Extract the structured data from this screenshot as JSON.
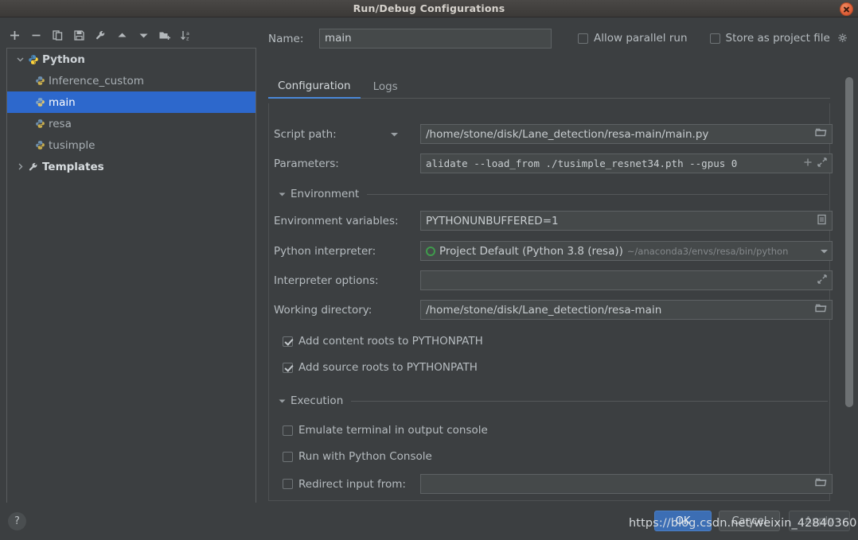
{
  "window": {
    "title": "Run/Debug Configurations",
    "close_icon": "close-icon"
  },
  "sidebar": {
    "toolbar": [
      {
        "name": "add-button",
        "icon": "plus-icon"
      },
      {
        "name": "remove-button",
        "icon": "minus-icon"
      },
      {
        "name": "copy-button",
        "icon": "copy-icon"
      },
      {
        "name": "save-button",
        "icon": "save-icon"
      },
      {
        "name": "edit-templates-button",
        "icon": "wrench-icon"
      },
      {
        "name": "move-up-button",
        "icon": "arrow-up-icon"
      },
      {
        "name": "move-down-button",
        "icon": "arrow-down-icon"
      },
      {
        "name": "new-folder-button",
        "icon": "folder-add-icon"
      },
      {
        "name": "sort-button",
        "icon": "sort-az-icon"
      }
    ],
    "tree": [
      {
        "label": "Python",
        "level": 0,
        "expanded": true,
        "icon": "python-icon",
        "selected": false
      },
      {
        "label": "Inference_custom",
        "level": 1,
        "icon": "python-icon",
        "selected": false
      },
      {
        "label": "main",
        "level": 1,
        "icon": "python-icon",
        "selected": true
      },
      {
        "label": "resa",
        "level": 1,
        "icon": "python-icon",
        "selected": false
      },
      {
        "label": "tusimple",
        "level": 1,
        "icon": "python-icon",
        "selected": false
      },
      {
        "label": "Templates",
        "level": 0,
        "expanded": false,
        "icon": "wrench-icon",
        "selected": false
      }
    ]
  },
  "header": {
    "name_label": "Name:",
    "name_value": "main",
    "allow_parallel_run": {
      "label": "Allow parallel run",
      "checked": false
    },
    "store_as_project_file": {
      "label": "Store as project file",
      "checked": false
    },
    "gear_icon": "gear-icon"
  },
  "tabs": [
    {
      "label": "Configuration",
      "active": true
    },
    {
      "label": "Logs",
      "active": false
    }
  ],
  "form": {
    "script_path": {
      "label": "Script path:",
      "value": "/home/stone/disk/Lane_detection/resa-main/main.py",
      "dropdown_icon": "chevron-down-icon",
      "browse_icon": "folder-icon"
    },
    "parameters": {
      "label": "Parameters:",
      "value": "alidate --load_from ./tusimple_resnet34.pth --gpus 0",
      "insert_icon": "plus-icon",
      "expand_icon": "expand-icon"
    },
    "environment_section": {
      "title": "Environment",
      "expanded": true
    },
    "environment_variables": {
      "label": "Environment variables:",
      "value": "PYTHONUNBUFFERED=1",
      "edit_icon": "list-edit-icon"
    },
    "python_interpreter": {
      "label": "Python interpreter:",
      "value": "Project Default (Python 3.8 (resa))",
      "hint": "~/anaconda3/envs/resa/bin/python",
      "status_icon": "conda-circle-icon",
      "dropdown_icon": "chevron-down-icon"
    },
    "interpreter_options": {
      "label": "Interpreter options:",
      "value": "",
      "expand_icon": "expand-icon"
    },
    "working_directory": {
      "label": "Working directory:",
      "value": "/home/stone/disk/Lane_detection/resa-main",
      "browse_icon": "folder-icon"
    },
    "add_content_roots": {
      "label": "Add content roots to PYTHONPATH",
      "checked": true
    },
    "add_source_roots": {
      "label": "Add source roots to PYTHONPATH",
      "checked": true
    },
    "execution_section": {
      "title": "Execution",
      "expanded": true
    },
    "emulate_terminal": {
      "label": "Emulate terminal in output console",
      "checked": false
    },
    "run_with_python_console": {
      "label": "Run with Python Console",
      "checked": false
    },
    "redirect_input": {
      "label": "Redirect input from:",
      "checked": false,
      "value": "",
      "browse_icon": "folder-icon"
    }
  },
  "footer": {
    "help_label": "?",
    "ok_label": "OK",
    "cancel_label": "Cancel",
    "apply_label": "Apply"
  },
  "watermark": {
    "text": "https://blog.csdn.net/weixin_42840360"
  },
  "colors": {
    "accent_selection": "#2d68cc",
    "panel_bg": "#3c3f41",
    "field_bg": "#45494a",
    "tab_underline": "#4a88d8",
    "close_button": "#e0613a",
    "ok_button": "#3c6eb4"
  }
}
